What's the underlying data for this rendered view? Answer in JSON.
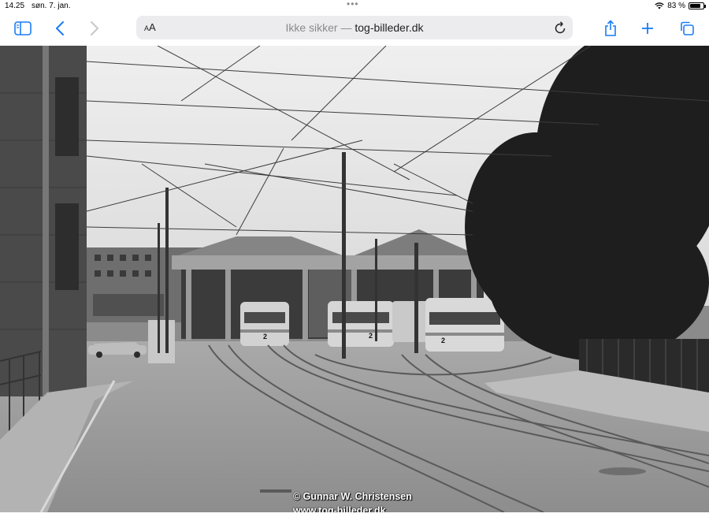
{
  "status_bar": {
    "time": "14.25",
    "date": "søn. 7. jan.",
    "battery": "83 %",
    "battery_level": 0.83
  },
  "browser": {
    "reader_label": "AA",
    "security_label": "Ikke sikker —",
    "domain": "tog-billeder.dk"
  },
  "photo": {
    "watermark_line1": "© Gunnar W. Christensen",
    "watermark_line2": "www.tog-billeder.dk",
    "tram_numbers": [
      "2",
      "2",
      "2"
    ]
  },
  "colors": {
    "accent": "#1a7cf5",
    "url_bar_bg": "#ececee",
    "insecure_text": "#8a8a8e"
  }
}
